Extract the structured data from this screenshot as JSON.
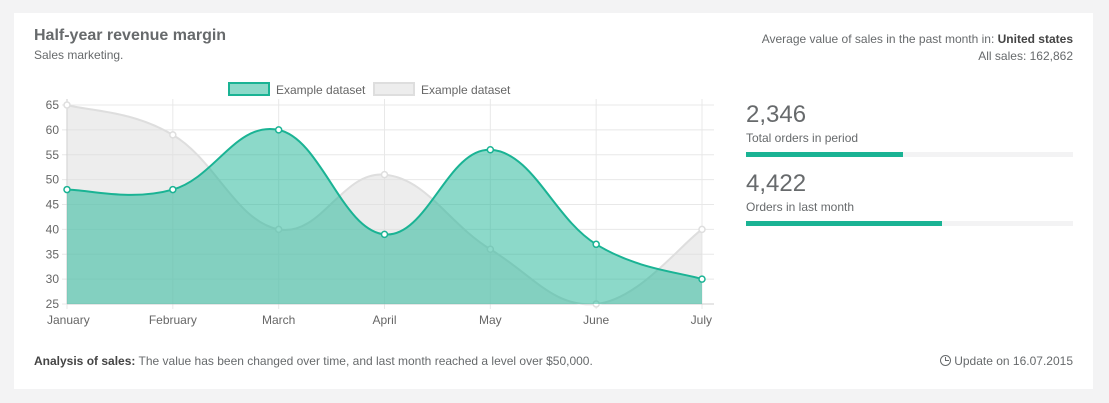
{
  "header": {
    "title": "Half-year revenue margin",
    "subtitle": "Sales marketing.",
    "avg_prefix": "Average value of sales in the past month in: ",
    "avg_region": "United states",
    "all_sales": "All sales: 162,862"
  },
  "stats": [
    {
      "value": "2,346",
      "label": "Total orders in period",
      "progress": 0.48
    },
    {
      "value": "4,422",
      "label": "Orders in last month",
      "progress": 0.6
    }
  ],
  "footer": {
    "analysis_label": "Analysis of sales:",
    "analysis_text": " The value has been changed over time, and last month reached a level over $50,000.",
    "update": "Update on 16.07.2015"
  },
  "colors": {
    "green_line": "#1ab394",
    "green_fill": "rgba(26,179,148,0.5)",
    "gray_line": "#dedede",
    "gray_fill": "rgba(220,220,220,0.5)"
  },
  "chart_data": {
    "type": "area",
    "categories": [
      "January",
      "February",
      "March",
      "April",
      "May",
      "June",
      "July"
    ],
    "ylim": [
      25,
      65
    ],
    "yticks": [
      25,
      30,
      35,
      40,
      45,
      50,
      55,
      60,
      65
    ],
    "grid": true,
    "legend_position": "top",
    "series": [
      {
        "name": "Example dataset",
        "color": "green",
        "values": [
          48,
          48,
          60,
          39,
          56,
          37,
          30
        ]
      },
      {
        "name": "Example dataset",
        "color": "gray",
        "values": [
          65,
          59,
          40,
          51,
          36,
          25,
          40
        ]
      }
    ]
  }
}
